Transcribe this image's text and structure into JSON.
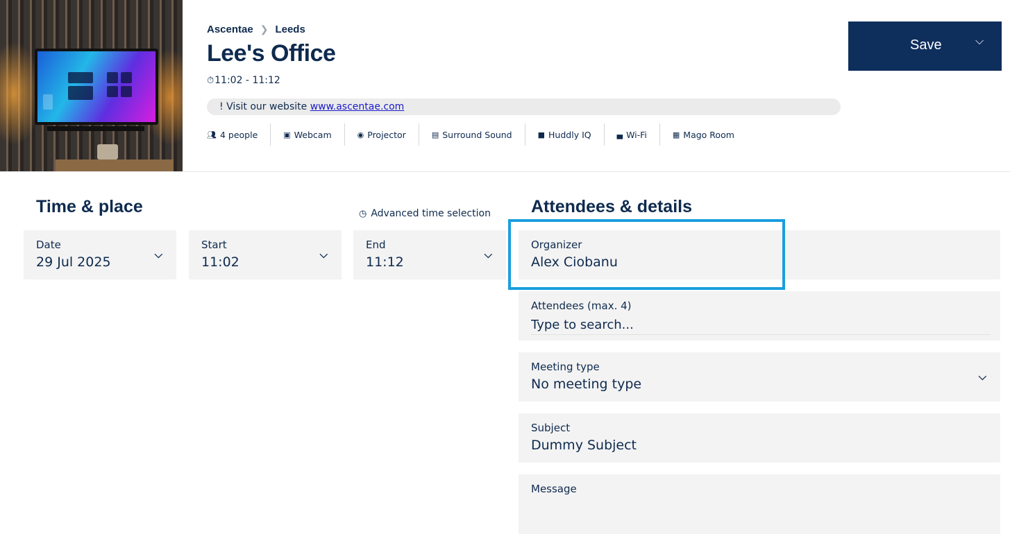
{
  "header": {
    "breadcrumb": {
      "org": "Ascentae",
      "location": "Leeds"
    },
    "room_title": "Lee's Office",
    "time_range": "11:02 - 11:12",
    "notice": {
      "prefix": "! Visit our website ",
      "link_text": "www.ascentae.com"
    },
    "amenities": [
      {
        "icon": "people-icon",
        "label": "4 people"
      },
      {
        "icon": "webcam-icon",
        "label": "Webcam"
      },
      {
        "icon": "projector-icon",
        "label": "Projector"
      },
      {
        "icon": "speaker-icon",
        "label": "Surround Sound"
      },
      {
        "icon": "camera-icon",
        "label": "Huddly IQ"
      },
      {
        "icon": "wifi-router-icon",
        "label": "Wi-Fi"
      },
      {
        "icon": "screen-icon",
        "label": "Mago Room"
      }
    ],
    "save_label": "Save"
  },
  "time_place": {
    "title": "Time & place",
    "advanced_link": "Advanced time selection",
    "date": {
      "label": "Date",
      "value": "29 Jul 2025"
    },
    "start": {
      "label": "Start",
      "value": "11:02"
    },
    "end": {
      "label": "End",
      "value": "11:12"
    }
  },
  "details": {
    "title": "Attendees & details",
    "organizer": {
      "label": "Organizer",
      "value": "Alex Ciobanu"
    },
    "attendees": {
      "label": "Attendees (max. 4)",
      "placeholder": "Type to search..."
    },
    "meeting_type": {
      "label": "Meeting type",
      "value": "No meeting type"
    },
    "subject": {
      "label": "Subject",
      "value": "Dummy Subject"
    },
    "message": {
      "label": "Message",
      "value": ""
    }
  },
  "colors": {
    "primary": "#0e2e5c",
    "text": "#0e2a4e",
    "field_bg": "#f3f3f3",
    "highlight": "#1a9ede"
  }
}
